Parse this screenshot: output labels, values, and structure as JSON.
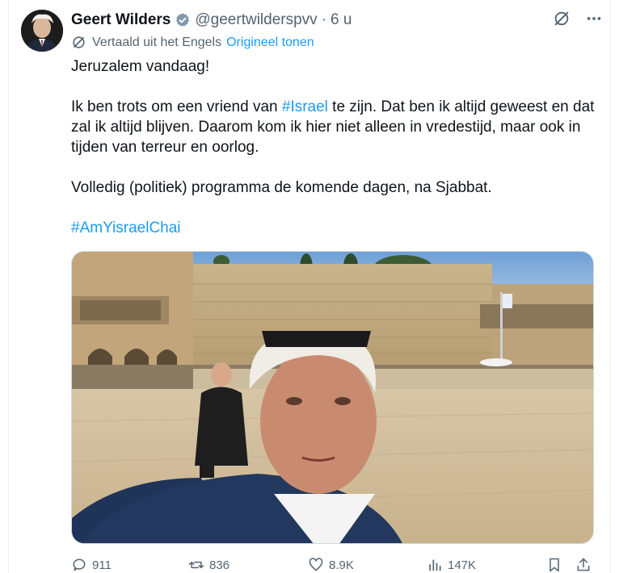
{
  "tweet": {
    "author_name": "Geert Wilders",
    "handle": "@geertwilderspvv",
    "separator": "·",
    "time": "6 u",
    "translation_note": "Vertaald uit het Engels",
    "show_original": "Origineel tonen",
    "line1": "Jeruzalem vandaag!",
    "para2_before": "Ik ben trots om een vriend van ",
    "para2_hashtag": "#Israel",
    "para2_after": " te zijn. Dat ben ik altijd geweest en dat zal ik altijd blijven. Daarom kom ik hier niet alleen in vredestijd, maar ook in tijden van terreur en oorlog.",
    "para3": "Volledig (politiek) programma de komende dagen, na Sjabbat.",
    "hashtag_line": "#AmYisraelChai"
  },
  "actions": {
    "replies": "911",
    "reposts": "836",
    "likes": "8.9K",
    "views": "147K"
  },
  "icons": [
    "verified-badge-icon",
    "grok-icon",
    "more-icon",
    "translate-icon",
    "reply-icon",
    "repost-icon",
    "like-icon",
    "views-icon",
    "bookmark-icon",
    "share-icon"
  ],
  "colors": {
    "link": "#1d9bf0",
    "secondary": "#536471",
    "text": "#0f1419"
  }
}
